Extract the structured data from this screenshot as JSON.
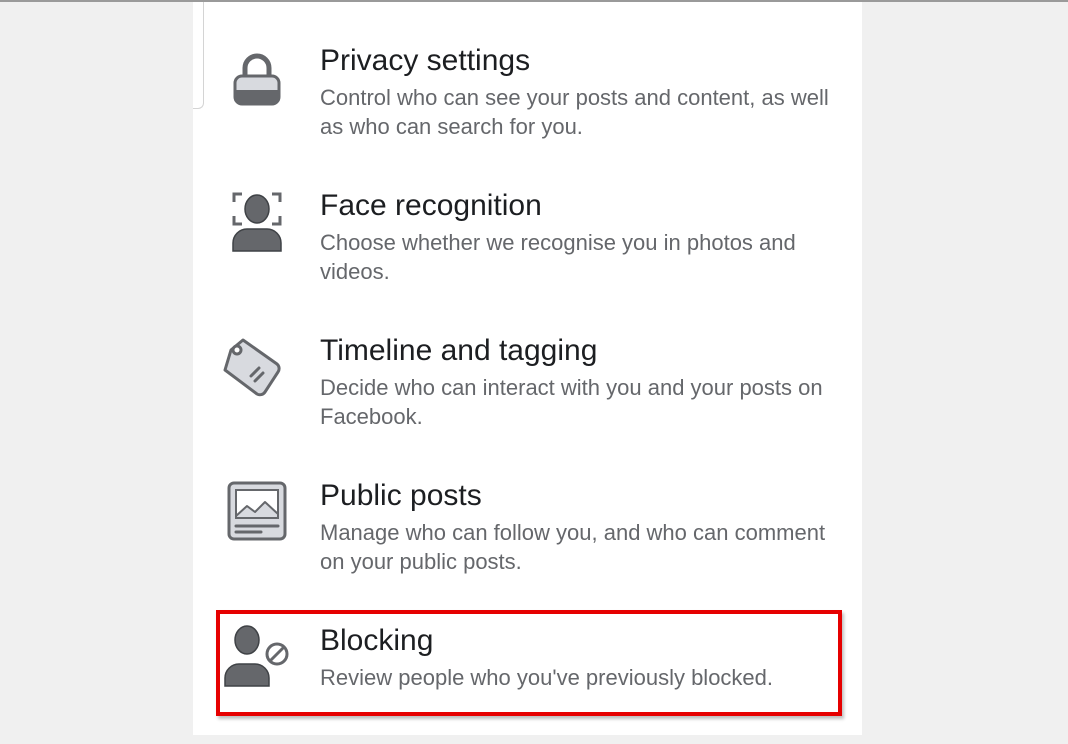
{
  "settings": {
    "items": [
      {
        "title": "Privacy settings",
        "description": "Control who can see your posts and content, as well as who can search for you.",
        "icon": "lock-icon"
      },
      {
        "title": "Face recognition",
        "description": "Choose whether we recognise you in photos and videos.",
        "icon": "face-scan-icon"
      },
      {
        "title": "Timeline and tagging",
        "description": "Decide who can interact with you and your posts on Facebook.",
        "icon": "tag-icon"
      },
      {
        "title": "Public posts",
        "description": "Manage who can follow you, and who can comment on your public posts.",
        "icon": "picture-frame-icon"
      },
      {
        "title": "Blocking",
        "description": "Review people who you've previously blocked.",
        "icon": "person-blocked-icon"
      }
    ]
  },
  "colors": {
    "title": "#1c1e21",
    "description": "#65676b",
    "icon_dark": "#65676b",
    "icon_light": "#d8dadf",
    "highlight": "#e60000",
    "page_background": "#f0f0f0"
  }
}
